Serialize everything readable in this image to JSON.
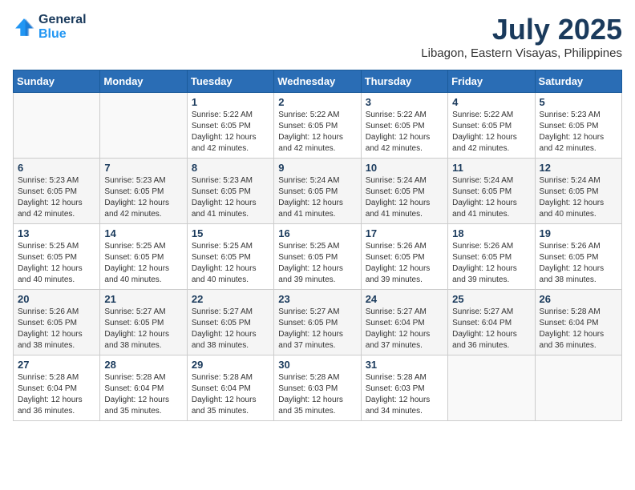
{
  "header": {
    "logo_line1": "General",
    "logo_line2": "Blue",
    "month_year": "July 2025",
    "location": "Libagon, Eastern Visayas, Philippines"
  },
  "weekdays": [
    "Sunday",
    "Monday",
    "Tuesday",
    "Wednesday",
    "Thursday",
    "Friday",
    "Saturday"
  ],
  "weeks": [
    [
      {
        "day": "",
        "sunrise": "",
        "sunset": "",
        "daylight": ""
      },
      {
        "day": "",
        "sunrise": "",
        "sunset": "",
        "daylight": ""
      },
      {
        "day": "1",
        "sunrise": "Sunrise: 5:22 AM",
        "sunset": "Sunset: 6:05 PM",
        "daylight": "Daylight: 12 hours and 42 minutes."
      },
      {
        "day": "2",
        "sunrise": "Sunrise: 5:22 AM",
        "sunset": "Sunset: 6:05 PM",
        "daylight": "Daylight: 12 hours and 42 minutes."
      },
      {
        "day": "3",
        "sunrise": "Sunrise: 5:22 AM",
        "sunset": "Sunset: 6:05 PM",
        "daylight": "Daylight: 12 hours and 42 minutes."
      },
      {
        "day": "4",
        "sunrise": "Sunrise: 5:22 AM",
        "sunset": "Sunset: 6:05 PM",
        "daylight": "Daylight: 12 hours and 42 minutes."
      },
      {
        "day": "5",
        "sunrise": "Sunrise: 5:23 AM",
        "sunset": "Sunset: 6:05 PM",
        "daylight": "Daylight: 12 hours and 42 minutes."
      }
    ],
    [
      {
        "day": "6",
        "sunrise": "Sunrise: 5:23 AM",
        "sunset": "Sunset: 6:05 PM",
        "daylight": "Daylight: 12 hours and 42 minutes."
      },
      {
        "day": "7",
        "sunrise": "Sunrise: 5:23 AM",
        "sunset": "Sunset: 6:05 PM",
        "daylight": "Daylight: 12 hours and 42 minutes."
      },
      {
        "day": "8",
        "sunrise": "Sunrise: 5:23 AM",
        "sunset": "Sunset: 6:05 PM",
        "daylight": "Daylight: 12 hours and 41 minutes."
      },
      {
        "day": "9",
        "sunrise": "Sunrise: 5:24 AM",
        "sunset": "Sunset: 6:05 PM",
        "daylight": "Daylight: 12 hours and 41 minutes."
      },
      {
        "day": "10",
        "sunrise": "Sunrise: 5:24 AM",
        "sunset": "Sunset: 6:05 PM",
        "daylight": "Daylight: 12 hours and 41 minutes."
      },
      {
        "day": "11",
        "sunrise": "Sunrise: 5:24 AM",
        "sunset": "Sunset: 6:05 PM",
        "daylight": "Daylight: 12 hours and 41 minutes."
      },
      {
        "day": "12",
        "sunrise": "Sunrise: 5:24 AM",
        "sunset": "Sunset: 6:05 PM",
        "daylight": "Daylight: 12 hours and 40 minutes."
      }
    ],
    [
      {
        "day": "13",
        "sunrise": "Sunrise: 5:25 AM",
        "sunset": "Sunset: 6:05 PM",
        "daylight": "Daylight: 12 hours and 40 minutes."
      },
      {
        "day": "14",
        "sunrise": "Sunrise: 5:25 AM",
        "sunset": "Sunset: 6:05 PM",
        "daylight": "Daylight: 12 hours and 40 minutes."
      },
      {
        "day": "15",
        "sunrise": "Sunrise: 5:25 AM",
        "sunset": "Sunset: 6:05 PM",
        "daylight": "Daylight: 12 hours and 40 minutes."
      },
      {
        "day": "16",
        "sunrise": "Sunrise: 5:25 AM",
        "sunset": "Sunset: 6:05 PM",
        "daylight": "Daylight: 12 hours and 39 minutes."
      },
      {
        "day": "17",
        "sunrise": "Sunrise: 5:26 AM",
        "sunset": "Sunset: 6:05 PM",
        "daylight": "Daylight: 12 hours and 39 minutes."
      },
      {
        "day": "18",
        "sunrise": "Sunrise: 5:26 AM",
        "sunset": "Sunset: 6:05 PM",
        "daylight": "Daylight: 12 hours and 39 minutes."
      },
      {
        "day": "19",
        "sunrise": "Sunrise: 5:26 AM",
        "sunset": "Sunset: 6:05 PM",
        "daylight": "Daylight: 12 hours and 38 minutes."
      }
    ],
    [
      {
        "day": "20",
        "sunrise": "Sunrise: 5:26 AM",
        "sunset": "Sunset: 6:05 PM",
        "daylight": "Daylight: 12 hours and 38 minutes."
      },
      {
        "day": "21",
        "sunrise": "Sunrise: 5:27 AM",
        "sunset": "Sunset: 6:05 PM",
        "daylight": "Daylight: 12 hours and 38 minutes."
      },
      {
        "day": "22",
        "sunrise": "Sunrise: 5:27 AM",
        "sunset": "Sunset: 6:05 PM",
        "daylight": "Daylight: 12 hours and 38 minutes."
      },
      {
        "day": "23",
        "sunrise": "Sunrise: 5:27 AM",
        "sunset": "Sunset: 6:05 PM",
        "daylight": "Daylight: 12 hours and 37 minutes."
      },
      {
        "day": "24",
        "sunrise": "Sunrise: 5:27 AM",
        "sunset": "Sunset: 6:04 PM",
        "daylight": "Daylight: 12 hours and 37 minutes."
      },
      {
        "day": "25",
        "sunrise": "Sunrise: 5:27 AM",
        "sunset": "Sunset: 6:04 PM",
        "daylight": "Daylight: 12 hours and 36 minutes."
      },
      {
        "day": "26",
        "sunrise": "Sunrise: 5:28 AM",
        "sunset": "Sunset: 6:04 PM",
        "daylight": "Daylight: 12 hours and 36 minutes."
      }
    ],
    [
      {
        "day": "27",
        "sunrise": "Sunrise: 5:28 AM",
        "sunset": "Sunset: 6:04 PM",
        "daylight": "Daylight: 12 hours and 36 minutes."
      },
      {
        "day": "28",
        "sunrise": "Sunrise: 5:28 AM",
        "sunset": "Sunset: 6:04 PM",
        "daylight": "Daylight: 12 hours and 35 minutes."
      },
      {
        "day": "29",
        "sunrise": "Sunrise: 5:28 AM",
        "sunset": "Sunset: 6:04 PM",
        "daylight": "Daylight: 12 hours and 35 minutes."
      },
      {
        "day": "30",
        "sunrise": "Sunrise: 5:28 AM",
        "sunset": "Sunset: 6:03 PM",
        "daylight": "Daylight: 12 hours and 35 minutes."
      },
      {
        "day": "31",
        "sunrise": "Sunrise: 5:28 AM",
        "sunset": "Sunset: 6:03 PM",
        "daylight": "Daylight: 12 hours and 34 minutes."
      },
      {
        "day": "",
        "sunrise": "",
        "sunset": "",
        "daylight": ""
      },
      {
        "day": "",
        "sunrise": "",
        "sunset": "",
        "daylight": ""
      }
    ]
  ]
}
